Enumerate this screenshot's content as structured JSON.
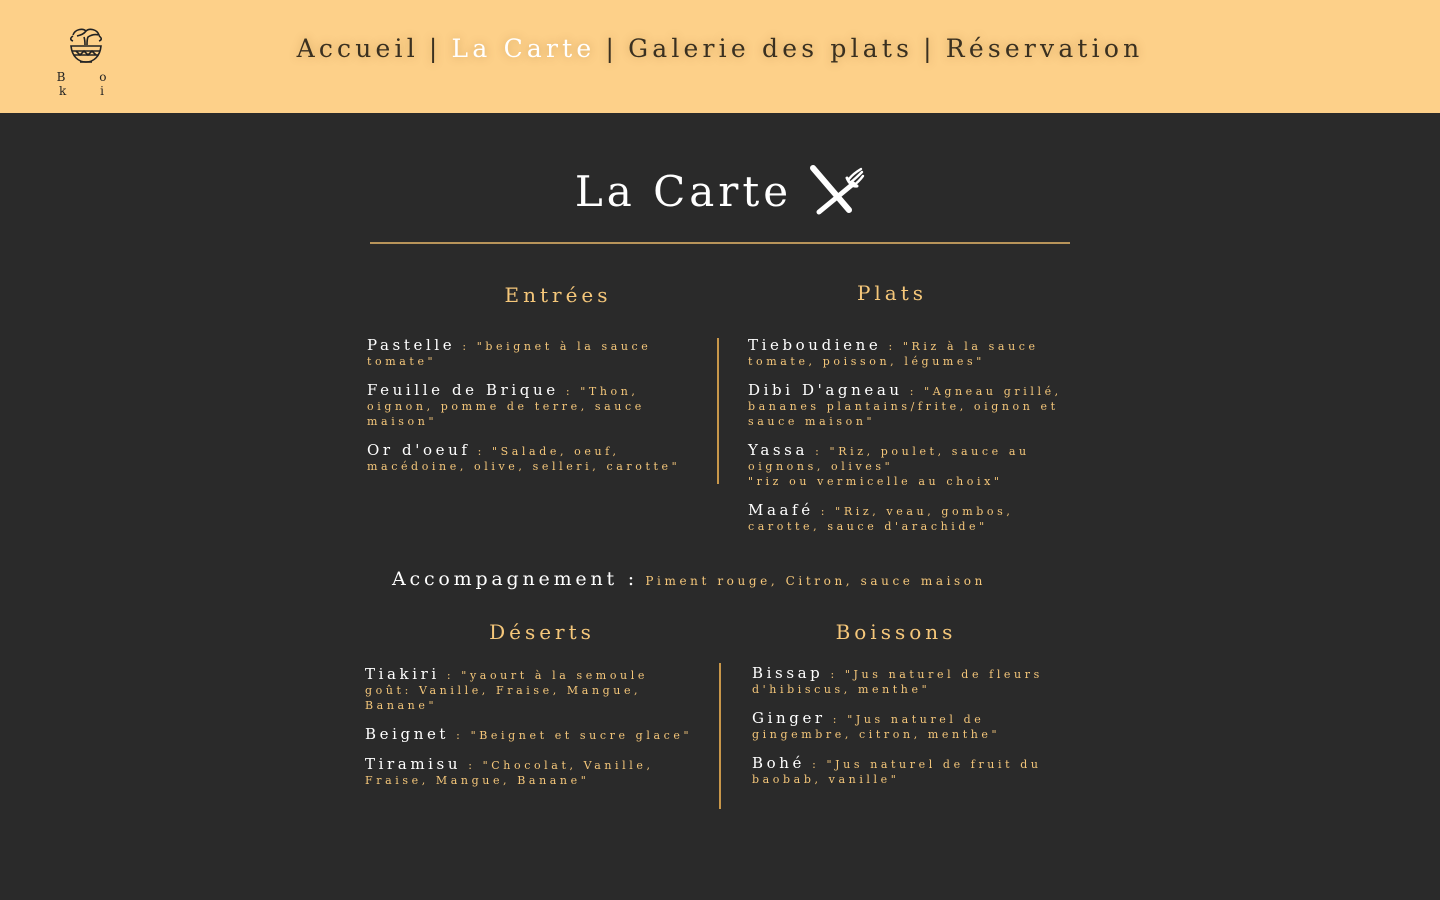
{
  "brand": {
    "name": "Boki",
    "letters": "B o k i"
  },
  "nav": {
    "items": [
      {
        "label": "Accueil"
      },
      {
        "label": "La Carte"
      },
      {
        "label": "Galerie des plats"
      },
      {
        "label": "Réservation"
      }
    ],
    "separator": "|"
  },
  "page": {
    "title": "La Carte",
    "icon": "fork-knife-icon"
  },
  "entrees": {
    "heading": "Entrées",
    "items": [
      {
        "name": "Pastelle",
        "desc": " : \"beignet à la sauce tomate\""
      },
      {
        "name": "Feuille de Brique",
        "desc": " : \"Thon, oignon, pomme de terre, sauce maison\""
      },
      {
        "name": "Or d'oeuf",
        "desc": " : \"Salade, oeuf, macédoine, olive, selleri, carotte\""
      }
    ]
  },
  "plats": {
    "heading": "Plats",
    "items": [
      {
        "name": "Tieboudiene",
        "desc": " : \"Riz à la sauce tomate, poisson, légumes\""
      },
      {
        "name": "Dibi D'agneau",
        "desc": " : \"Agneau grillé, bananes plantains/frite, oignon et sauce maison\""
      },
      {
        "name": "Yassa",
        "desc": " : \"Riz, poulet, sauce au oignons, olives\"",
        "desc2": "\"riz ou vermicelle au choix\""
      },
      {
        "name": "Maafé",
        "desc": " : \"Riz, veau, gombos, carotte, sauce d'arachide\""
      }
    ]
  },
  "accompagnement": {
    "label": "Accompagnement :",
    "value": " Piment rouge, Citron, sauce maison"
  },
  "deserts": {
    "heading": "Déserts",
    "items": [
      {
        "name": "Tiakiri",
        "desc": " : \"yaourt à la semoule goût: Vanille, Fraise, Mangue, Banane\""
      },
      {
        "name": "Beignet",
        "desc": " : \"Beignet et sucre glace\""
      },
      {
        "name": "Tiramisu",
        "desc": " : \"Chocolat, Vanille, Fraise, Mangue, Banane\""
      }
    ]
  },
  "boissons": {
    "heading": "Boissons",
    "items": [
      {
        "name": "Bissap",
        "desc": " : \"Jus naturel de fleurs d'hibiscus, menthe\""
      },
      {
        "name": "Ginger",
        "desc": " : \"Jus naturel de gingembre, citron, menthe\""
      },
      {
        "name": "Bohé",
        "desc": " : \"Jus naturel de fruit du baobab, vanille\""
      }
    ]
  },
  "colors": {
    "header_bg": "#fdd089",
    "page_bg": "#2a2a2a",
    "accent": "#f5c77a",
    "divider": "#c8974a"
  }
}
